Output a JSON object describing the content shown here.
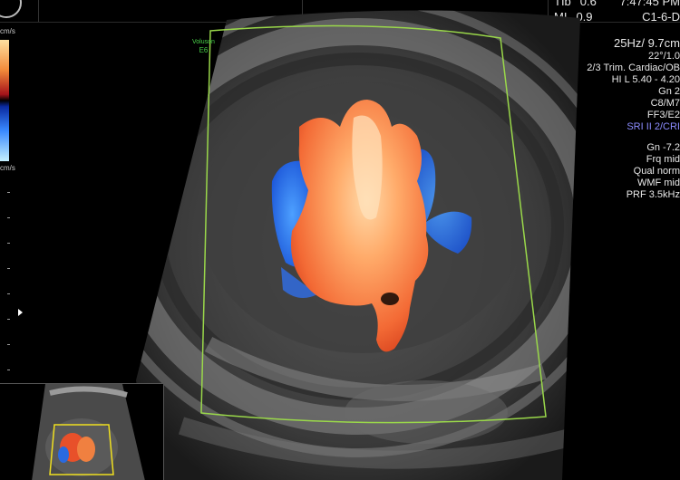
{
  "top_bar": {
    "tib_label": "TIb",
    "tib_value": "0.6",
    "mi_label": "MI",
    "mi_value": "0.9",
    "time": "7:47:45 PM",
    "probe": "C1-6-D"
  },
  "params": {
    "frame_rate_depth": "25Hz/ 9.7cm",
    "angle": "22°/1.0",
    "preset": "2/3 Trim. Cardiac/OB",
    "hi_line": "HI L  5.40 - 4.20",
    "gn_top": "Gn   2",
    "map": "C8/M7",
    "ff": "FF3/E2",
    "sri": "SRI II 2/CRI",
    "gn": "Gn -7.2",
    "frq": "Frq mid",
    "qual": "Qual norm",
    "wmf": "WMF mid",
    "prf": "PRF  3.5kHz"
  },
  "color_scale": {
    "top_label": "cm/s",
    "bottom_label": "cm/s",
    "colors": [
      "#ffe0a0",
      "#f28a3a",
      "#a5121a",
      "#000000",
      "#0a2aa0",
      "#3a8aff",
      "#c4f0ff"
    ]
  },
  "brand": {
    "line1": "Voluson",
    "line2": "E6"
  },
  "overlay_color": "#9ad84a"
}
